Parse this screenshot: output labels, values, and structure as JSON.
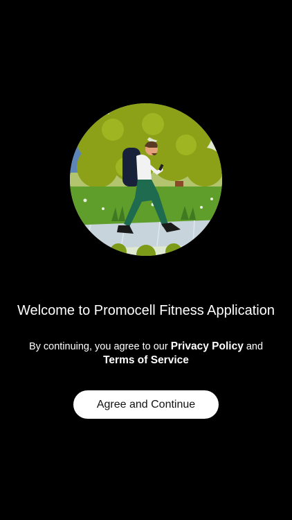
{
  "onboarding": {
    "illustration": "person-walking-with-backpack-in-park-illustration",
    "welcome_title": "Welcome to Promocell Fitness Application",
    "consent": {
      "prefix": "By continuing, you agree to our ",
      "privacy_link": "Privacy Policy",
      "joiner": " and ",
      "terms_link": "Terms of Service"
    },
    "agree_button": "Agree and Continue"
  },
  "colors": {
    "background": "#000000",
    "text": "#ffffff",
    "button_bg": "#ffffff",
    "button_text": "#111111",
    "foliage": "#8ca018",
    "grass": "#5f9e2a",
    "pants": "#1f6b4f"
  }
}
